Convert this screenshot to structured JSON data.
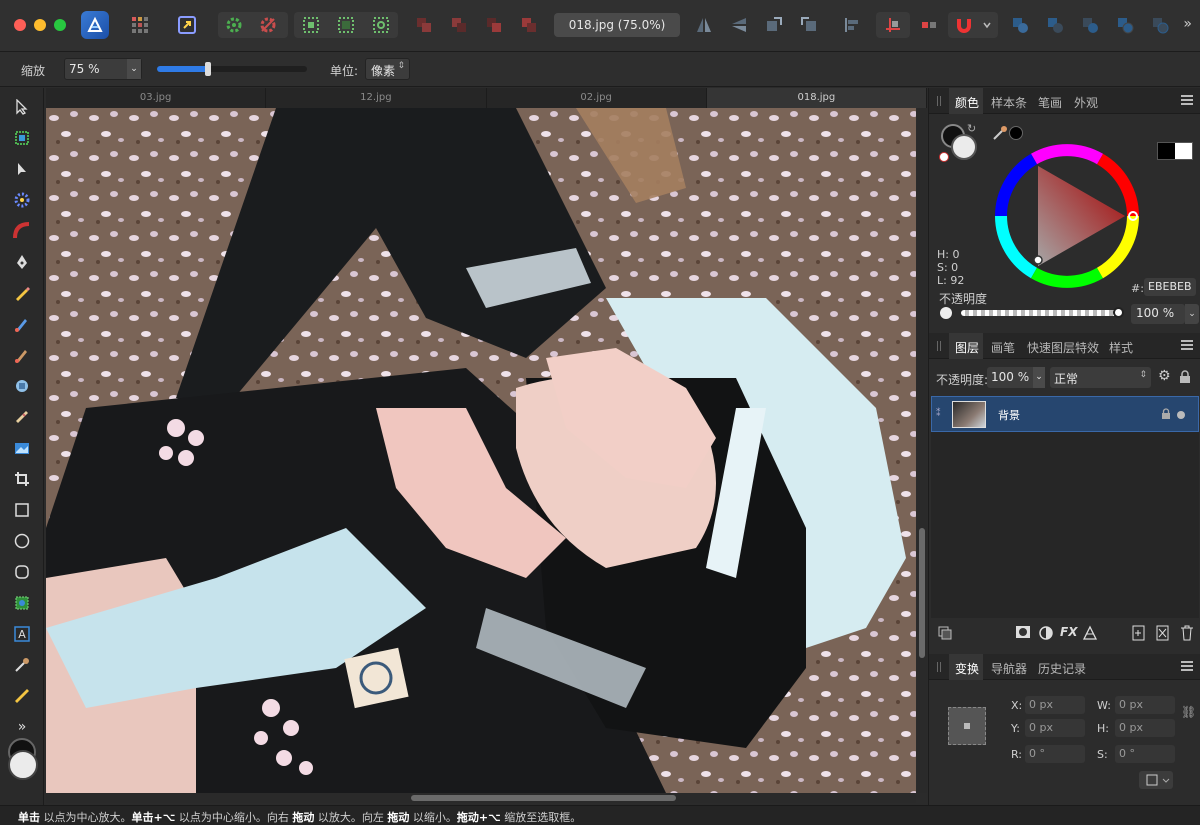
{
  "document": {
    "title": "018.jpg (75.0%)"
  },
  "context_bar": {
    "zoom_label": "缩放",
    "zoom_value": "75 %",
    "zoom_slider_fraction": 0.34,
    "unit_label": "单位:",
    "unit_value": "像素"
  },
  "doc_tabs": [
    {
      "label": "03.jpg"
    },
    {
      "label": "12.jpg"
    },
    {
      "label": "02.jpg"
    },
    {
      "label": "018.jpg"
    }
  ],
  "color_panel": {
    "tabs": [
      "颜色",
      "样本条",
      "笔画",
      "外观"
    ],
    "h": "H: 0",
    "s": "S: 0",
    "l": "L: 92",
    "hex_label": "#:",
    "hex_value": "EBEBEB",
    "opacity_label": "不透明度",
    "opacity_value": "100 %",
    "opacity_fraction": 1.0,
    "primary_color": "#EBEBEB"
  },
  "layers_panel": {
    "tabs": [
      "图层",
      "画笔",
      "快速图层特效",
      "样式"
    ],
    "opacity_label": "不透明度:",
    "opacity_value": "100 %",
    "blend_mode": "正常",
    "layers": [
      {
        "name": "背景",
        "selected": true
      }
    ]
  },
  "transform_panel": {
    "tabs": [
      "变换",
      "导航器",
      "历史记录"
    ],
    "x_label": "X:",
    "x_value": "0 px",
    "y_label": "Y:",
    "y_value": "0 px",
    "w_label": "W:",
    "w_value": "0 px",
    "h_label": "H:",
    "h_value": "0 px",
    "r_label": "R:",
    "r_value": "0 °",
    "s_label": "S:",
    "s_value": "0 °"
  },
  "status_bar": {
    "parts": [
      {
        "text": "单击",
        "bold": true
      },
      {
        "text": " 以点为中心放大。",
        "bold": false
      },
      {
        "text": "单击+⌥",
        "bold": true
      },
      {
        "text": " 以点为中心缩小。向右 ",
        "bold": false
      },
      {
        "text": "拖动",
        "bold": true
      },
      {
        "text": " 以放大。向左 ",
        "bold": false
      },
      {
        "text": "拖动",
        "bold": true
      },
      {
        "text": " 以缩小。",
        "bold": false
      },
      {
        "text": "拖动+⌥",
        "bold": true
      },
      {
        "text": " 缩放至选取框。",
        "bold": false
      }
    ]
  },
  "colors": {
    "accent": "#2f7be6",
    "selection": "#26466f",
    "app_bg": "#2b2b2b"
  }
}
